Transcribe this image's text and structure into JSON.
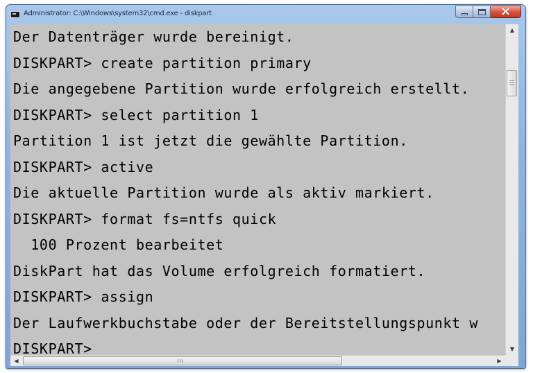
{
  "window": {
    "title": "Administrator: C:\\Windows\\system32\\cmd.exe - diskpart",
    "title_icon": "cmd-console-icon",
    "buttons": {
      "minimize_icon": "minimize-icon",
      "maximize_icon": "maximize-icon",
      "close_icon": "close-icon"
    }
  },
  "console": {
    "background": "#c3c3c3",
    "foreground": "#000000",
    "lines": [
      "Der Datenträger wurde bereinigt.",
      "DISKPART> create partition primary",
      "Die angegebene Partition wurde erfolgreich erstellt.",
      "DISKPART> select partition 1",
      "Partition 1 ist jetzt die gewählte Partition.",
      "DISKPART> active",
      "Die aktuelle Partition wurde als aktiv markiert.",
      "DISKPART> format fs=ntfs quick",
      "  100 Prozent bearbeitet",
      "DiskPart hat das Volume erfolgreich formatiert.",
      "DISKPART> assign",
      "Der Laufwerkbuchstabe oder der Bereitstellungspunkt w",
      "DISKPART>"
    ]
  },
  "scrollbars": {
    "up_arrow": "▲",
    "down_arrow": "▼",
    "left_arrow": "◀",
    "right_arrow": "▶"
  }
}
